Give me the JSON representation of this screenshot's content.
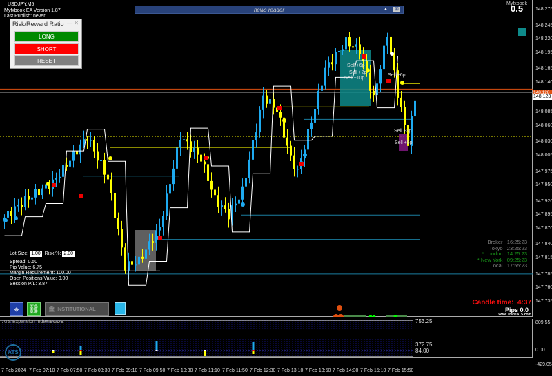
{
  "header": {
    "symbol": "USDJPY,M5",
    "ea_version": "Myfxbook EA Version 1.87",
    "last_publish": "Last Publish: never",
    "top_right_label": "Myfxbook",
    "top_right_value": "0.5"
  },
  "risk_reward": {
    "title": "Risk/Reward Ratio",
    "minimize": "—",
    "close": "✕",
    "long": "LONG",
    "short": "SHORT",
    "reset": "RESET",
    "colors": {
      "long": "#008a00",
      "short": "#ff0000",
      "reset": "#808080"
    }
  },
  "news_reader": {
    "title": "news reader",
    "up": "▲",
    "close": "⊠"
  },
  "trade_panel": {
    "lot_label": "Lot Size:",
    "lot_value": "1.00",
    "risk_label": "Risk %:",
    "risk_value": "2.00",
    "spread": "Spread: 0.50",
    "pip_value": "Pip Value: 6.75",
    "margin": "Margin Requirement: 100.00",
    "open_positions": "Open Positions Value: 0.00",
    "session_pl": "Session P/L: 3.87"
  },
  "toolbar": {
    "institutional_mode": "INSTITUTIONAL MODE"
  },
  "sessions": [
    {
      "name": "Broker",
      "time": "16:25:23",
      "color": "#808080"
    },
    {
      "name": "Tokyo",
      "time": "23:25:23",
      "color": "#808080"
    },
    {
      "name": "* London",
      "time": "14:25:23",
      "color": "#1a9a1a"
    },
    {
      "name": "* New York",
      "time": "09:25:23",
      "color": "#1a9a1a"
    },
    {
      "name": "Local",
      "time": "17:55:23",
      "color": "#808080"
    }
  ],
  "candle": {
    "label": "Candle time:",
    "value": "4:37",
    "pips": "Pips 0.0",
    "site": "www.TradeATS.com"
  },
  "trade_labels": [
    "Sell +6p",
    "Sell +2p",
    "Sell +10p",
    "Sell +6p",
    "Sell +3p",
    "Sell +5p"
  ],
  "price_axis": [
    "148.275",
    "148.245",
    "148.220",
    "148.195",
    "148.165",
    "148.140",
    "148.110",
    "148.085",
    "148.060",
    "148.030",
    "148.005",
    "147.975",
    "147.950",
    "147.920",
    "147.895",
    "147.870",
    "147.840",
    "147.815",
    "147.785",
    "147.760",
    "147.735"
  ],
  "current_price": {
    "bid": "148.123",
    "ask": "148.128"
  },
  "sub_window": {
    "title": "ATS Expansion Index V4.0",
    "logo": "ATS",
    "levels": [
      "753.25",
      "84.00",
      "372.75"
    ],
    "axis": [
      "809.55",
      "0.00",
      "-429.05"
    ]
  },
  "time_axis": [
    "7 Feb 2024",
    "7 Feb 07:10",
    "7 Feb 07:50",
    "7 Feb 08:30",
    "7 Feb 09:10",
    "7 Feb 09:50",
    "7 Feb 10:30",
    "7 Feb 11:10",
    "7 Feb 11:50",
    "7 Feb 12:30",
    "7 Feb 13:10",
    "7 Feb 13:50",
    "7 Feb 14:30",
    "7 Feb 15:10",
    "7 Feb 15:50"
  ],
  "chart_data": {
    "type": "candlestick",
    "symbol": "USDJPY",
    "timeframe": "M5",
    "ylim": [
      147.735,
      148.275
    ],
    "close_path": [
      [
        0,
        147.885
      ],
      [
        7,
        147.923
      ],
      [
        15,
        147.955
      ],
      [
        25,
        148.04
      ],
      [
        31,
        147.962
      ],
      [
        36,
        147.8
      ],
      [
        40,
        147.81
      ],
      [
        46,
        147.872
      ],
      [
        52,
        148.04
      ],
      [
        58,
        148.0
      ],
      [
        62,
        147.925
      ],
      [
        66,
        147.895
      ],
      [
        70,
        147.94
      ],
      [
        76,
        148.114
      ],
      [
        80,
        148.09
      ],
      [
        84,
        148.0
      ],
      [
        86,
        147.975
      ],
      [
        90,
        148.07
      ],
      [
        94,
        148.165
      ],
      [
        100,
        148.216
      ],
      [
        104,
        148.2
      ],
      [
        108,
        148.11
      ],
      [
        112,
        148.23
      ],
      [
        115,
        148.12
      ],
      [
        118,
        148.03
      ],
      [
        120,
        148.11
      ]
    ],
    "colors": {
      "up": "#1eaaf0",
      "down": "#ffff00"
    }
  }
}
